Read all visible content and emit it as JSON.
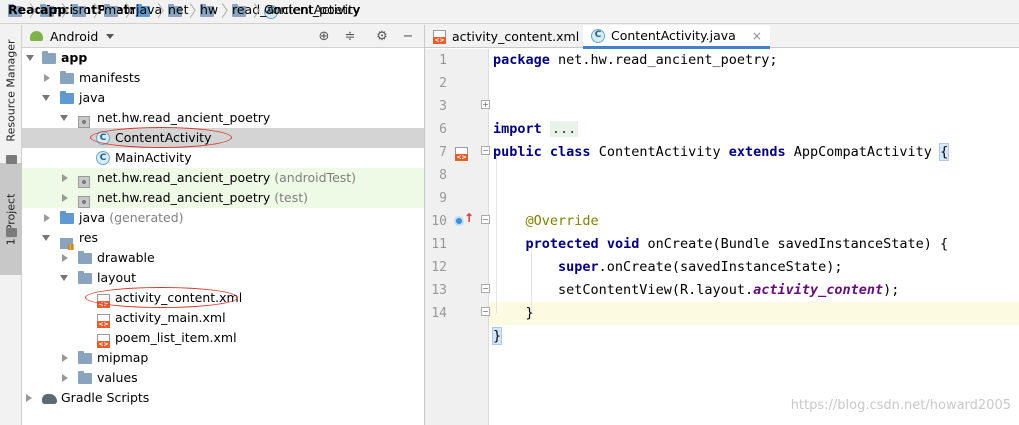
{
  "breadcrumb": [
    {
      "label": "ReadAncientPoetry",
      "bold": true,
      "icon": "folder-icon"
    },
    {
      "label": "app",
      "bold": true,
      "icon": "folder-icon"
    },
    {
      "label": "src",
      "icon": "folder-icon"
    },
    {
      "label": "main",
      "icon": "folder-icon"
    },
    {
      "label": "java",
      "icon": "folder-icon"
    },
    {
      "label": "net",
      "icon": "folder-icon"
    },
    {
      "label": "hw",
      "icon": "folder-icon"
    },
    {
      "label": "read_ancient_poetry",
      "icon": "folder-icon"
    },
    {
      "label": "ContentActivity",
      "icon": "class-icon"
    }
  ],
  "toolstrip": {
    "resource_manager": "Resource Manager",
    "project": "1: Project"
  },
  "project_panel": {
    "view_selector": "Android",
    "tree": [
      {
        "label": "app",
        "bold": true
      },
      {
        "label": "manifests"
      },
      {
        "label": "java"
      },
      {
        "label": "net.hw.read_ancient_poetry"
      },
      {
        "label": "ContentActivity"
      },
      {
        "label": "MainActivity"
      },
      {
        "label": "net.hw.read_ancient_poetry",
        "suffix": "(androidTest)"
      },
      {
        "label": "net.hw.read_ancient_poetry",
        "suffix": "(test)"
      },
      {
        "label": "java",
        "suffix": "(generated)"
      },
      {
        "label": "res"
      },
      {
        "label": "drawable"
      },
      {
        "label": "layout"
      },
      {
        "label": "activity_content.xml"
      },
      {
        "label": "activity_main.xml"
      },
      {
        "label": "poem_list_item.xml"
      },
      {
        "label": "mipmap"
      },
      {
        "label": "values"
      },
      {
        "label": "Gradle Scripts"
      }
    ]
  },
  "editor": {
    "tabs": [
      {
        "label": "activity_content.xml",
        "active": false
      },
      {
        "label": "ContentActivity.java",
        "active": true,
        "close": "×"
      }
    ],
    "line_numbers": [
      "1",
      "2",
      "3",
      "6",
      "7",
      "8",
      "9",
      "10",
      "11",
      "12",
      "13",
      "14"
    ],
    "code": {
      "l1_kw": "package",
      "l1_rest": " net.hw.read_ancient_poetry;",
      "l3_kw": "import",
      "l3_dots": "...",
      "l7_kw1": "public",
      "l7_kw2": "class",
      "l7_name": " ContentActivity ",
      "l7_kw3": "extends",
      "l7_parent": " AppCompatActivity ",
      "l7_brace": "{",
      "l9_ann": "@Override",
      "l10_kw1": "protected",
      "l10_kw2": "void",
      "l10_rest": " onCreate(Bundle savedInstanceState) {",
      "l11_kw": "super",
      "l11_rest": ".onCreate(savedInstanceState);",
      "l12_pre": "setContentView(R.layout.",
      "l12_field": "activity_content",
      "l12_post": ");",
      "l13": "}",
      "l14": "}"
    }
  },
  "watermark": "https://blog.csdn.net/howard2005",
  "colors": {
    "keyword": "#000080",
    "annotation": "#808000",
    "field": "#660e7a",
    "selection": "#d4d4d4",
    "test_source_bg": "#eef9e6",
    "highlight_oval": "#d9352a",
    "active_tab_accent": "#4083c9"
  }
}
